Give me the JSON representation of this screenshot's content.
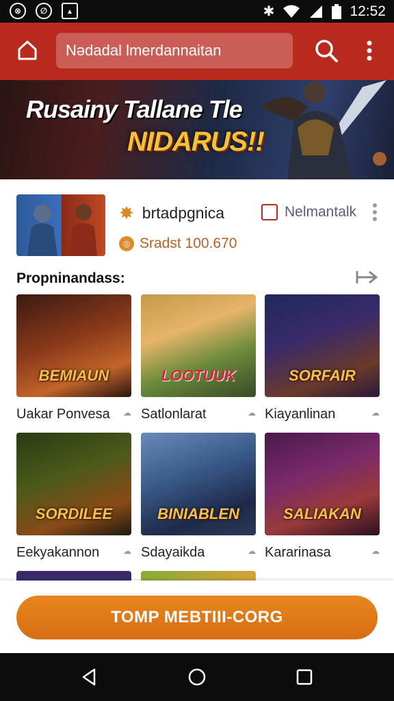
{
  "status_bar": {
    "time": "12:52",
    "left_icons": [
      "notification-app-icon",
      "notification-app-icon",
      "image-icon"
    ],
    "right_icons": [
      "bluetooth-icon",
      "wifi-icon",
      "signal-icon",
      "battery-icon"
    ]
  },
  "top_bar": {
    "search_text": "Nǝdadal lmerdannaitan",
    "accent_color": "#b8291e"
  },
  "banner": {
    "title_line1": "Rusainy Tallane Tle",
    "title_line2": "NIDARUS!!"
  },
  "featured": {
    "name": "brtadpgnica",
    "developer": "Nelmantalk",
    "stat": "Sradst 100.670"
  },
  "section": {
    "title": "Propninandass:"
  },
  "games": [
    {
      "art_title": "BEMIAUN",
      "caption": "Uakar Ponvesa",
      "icon": "cloud-icon"
    },
    {
      "art_title": "LOOTUUK",
      "caption": "Satlonlarat",
      "icon": "cloud-icon"
    },
    {
      "art_title": "SORFAIR",
      "caption": "Kiayanlinan",
      "icon": "cloud-icon"
    },
    {
      "art_title": "SORDILEE",
      "caption": "Eekyakannon",
      "icon": "cloud-icon"
    },
    {
      "art_title": "BINIABLEN",
      "caption": "Sdayaikda",
      "icon": "cloud-icon"
    },
    {
      "art_title": "SALIAKAN",
      "caption": "Kararinasa",
      "icon": "cloud-icon"
    }
  ],
  "cta": {
    "label": "TOMP MEBTIII-CORG",
    "color": "#e07c1a"
  }
}
